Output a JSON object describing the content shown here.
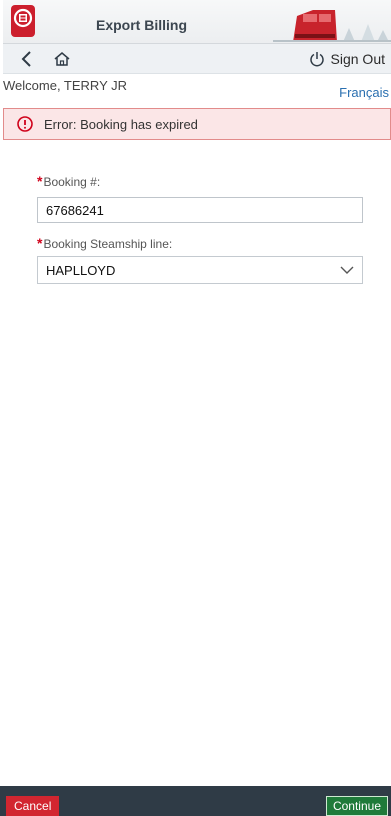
{
  "header": {
    "title": "Export Billing",
    "logo_icon": "railway-logo-icon",
    "banner_art": "train-illustration"
  },
  "nav": {
    "back_icon": "chevron-left-icon",
    "home_icon": "home-icon",
    "signout_icon": "power-icon",
    "signout_label": "Sign Out"
  },
  "welcome": {
    "text": "Welcome, TERRY JR",
    "language_link": "Français"
  },
  "error": {
    "icon": "alert-circle-icon",
    "message": "Error: Booking has expired",
    "color": "#d0021b"
  },
  "form": {
    "booking_label": "Booking #:",
    "booking_value": "67686241",
    "steamship_label": "Booking Steamship line:",
    "steamship_selected": "HAPLLOYD",
    "required_marker": "*"
  },
  "footer": {
    "cancel_label": "Cancel",
    "continue_label": "Continue",
    "cancel_color": "#d22630",
    "continue_color": "#1f7a3a"
  }
}
